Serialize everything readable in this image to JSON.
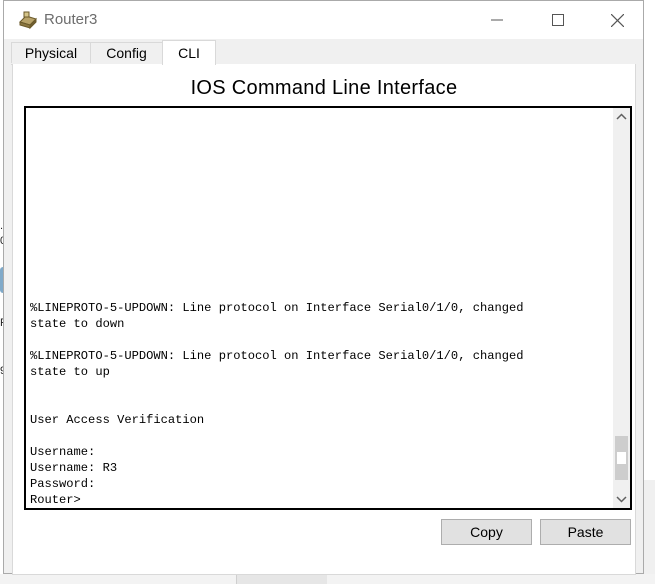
{
  "window": {
    "title": "Router3",
    "controls": {
      "minimize": "—",
      "maximize": "☐",
      "close": "✕"
    }
  },
  "tabs": [
    {
      "label": "Physical",
      "active": false
    },
    {
      "label": "Config",
      "active": false
    },
    {
      "label": "CLI",
      "active": true
    }
  ],
  "cli": {
    "heading": "IOS Command Line Interface",
    "output_lines": [
      "%LINEPROTO-5-UPDOWN: Line protocol on Interface Serial0/1/0, changed",
      "state to down",
      "",
      "%LINEPROTO-5-UPDOWN: Line protocol on Interface Serial0/1/0, changed",
      "state to up",
      "",
      "",
      "User Access Verification",
      "",
      "Username:",
      "Username: R3",
      "Password:",
      "Router>"
    ]
  },
  "buttons": {
    "copy": "Copy",
    "paste": "Paste"
  },
  "icons": {
    "scroll_up": "chevron-up-icon",
    "scroll_down": "chevron-down-icon",
    "app": "router-icon"
  },
  "background_fragments": [
    ".1",
    "0",
    ".C",
    "R",
    "9"
  ]
}
